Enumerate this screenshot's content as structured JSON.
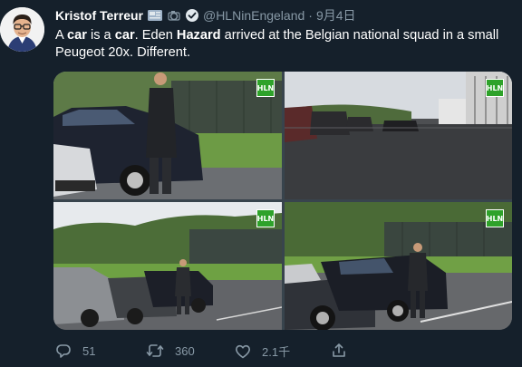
{
  "tweet": {
    "author_name": "Kristof Terreur",
    "handle": "@HLNinEngeland",
    "separator": "·",
    "date": "9月4日",
    "text_parts": [
      "A ",
      "car",
      " is a ",
      "car",
      ". Eden ",
      "Hazard",
      " arrived at the Belgian national squad in a small Peugeot 20x. Different."
    ]
  },
  "media": {
    "watermark": "HLN",
    "photo_count": 4
  },
  "actions": {
    "replies": "51",
    "retweets": "360",
    "likes": "2.1千"
  },
  "colors": {
    "background": "#15202b",
    "secondary_text": "#8899a6",
    "watermark_green": "#2ea22a"
  },
  "icons": [
    "reply-icon",
    "retweet-icon",
    "like-icon",
    "share-icon",
    "verified-icon",
    "flag-icon"
  ]
}
